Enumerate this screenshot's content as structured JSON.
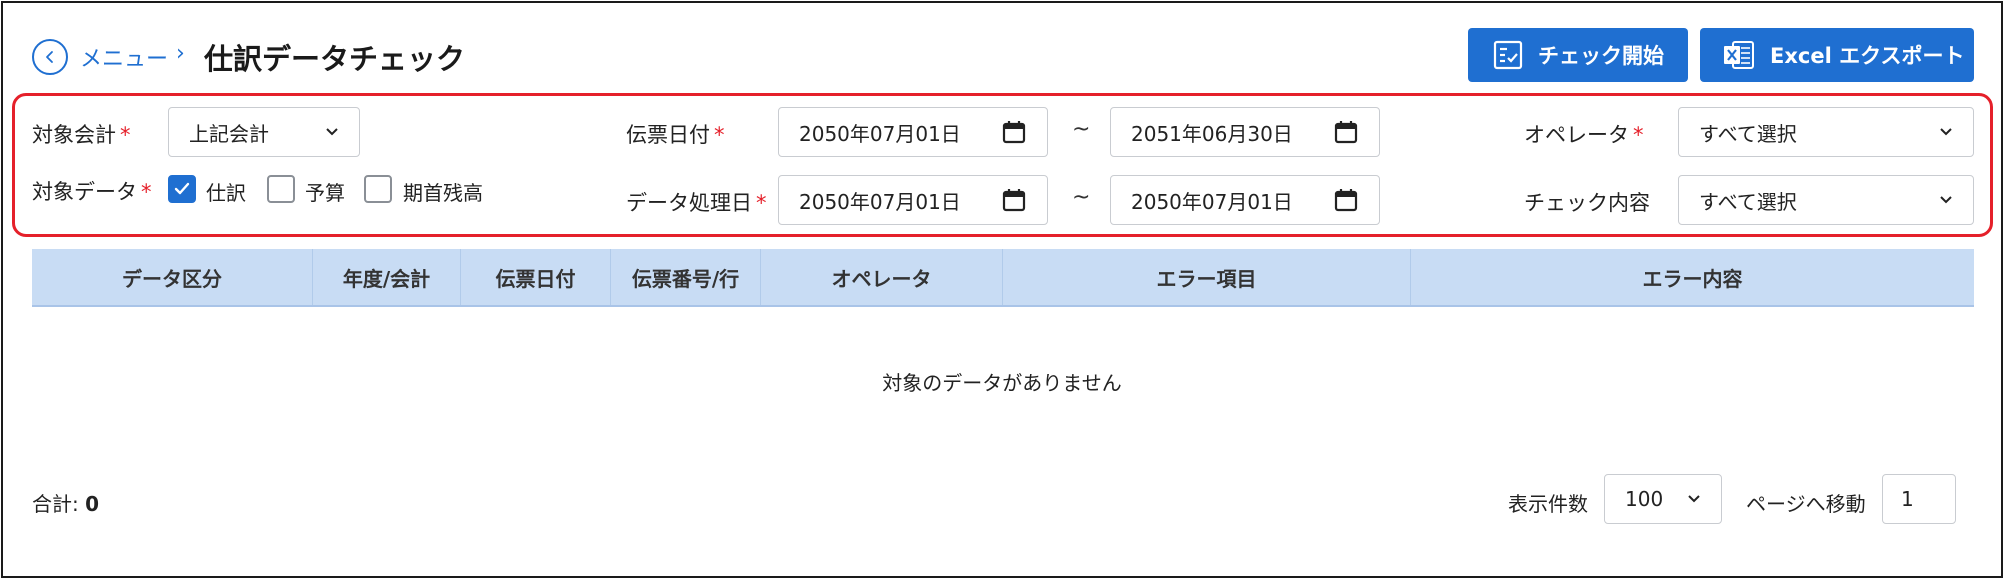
{
  "header": {
    "breadcrumb_parent": "メニュー",
    "breadcrumb_separator": "›",
    "title": "仕訳データチェック"
  },
  "toolbar": {
    "check_start_label": "チェック開始",
    "excel_export_label": "Excel エクスポート"
  },
  "filters": {
    "target_accounting": {
      "label": "対象会計",
      "value": "上記会計"
    },
    "slip_date": {
      "label": "伝票日付",
      "from": "2050年07月01日",
      "to": "2051年06月30日"
    },
    "operator": {
      "label": "オペレータ",
      "value": "すべて選択"
    },
    "target_data": {
      "label": "対象データ",
      "options": [
        {
          "label": "仕訳",
          "checked": true
        },
        {
          "label": "予算",
          "checked": false
        },
        {
          "label": "期首残高",
          "checked": false
        }
      ]
    },
    "processing_date": {
      "label": "データ処理日",
      "from": "2050年07月01日",
      "to": "2050年07月01日"
    },
    "check_content": {
      "label": "チェック内容",
      "value": "すべて選択"
    },
    "required_mark": "*",
    "range_separator": "~"
  },
  "table": {
    "columns": [
      "データ区分",
      "年度/会計",
      "伝票日付",
      "伝票番号/行",
      "オペレータ",
      "エラー項目",
      "エラー内容"
    ],
    "empty_message": "対象のデータがありません"
  },
  "footer": {
    "total_label": "合計:",
    "total_value": "0",
    "page_size_label": "表示件数",
    "page_size_value": "100",
    "goto_page_label": "ページへ移動",
    "goto_page_value": "1"
  },
  "colors": {
    "accent": "#1f6fd1",
    "required": "#e5202a",
    "highlight_border": "#e5202a",
    "table_header_bg": "#c8dcf4"
  }
}
